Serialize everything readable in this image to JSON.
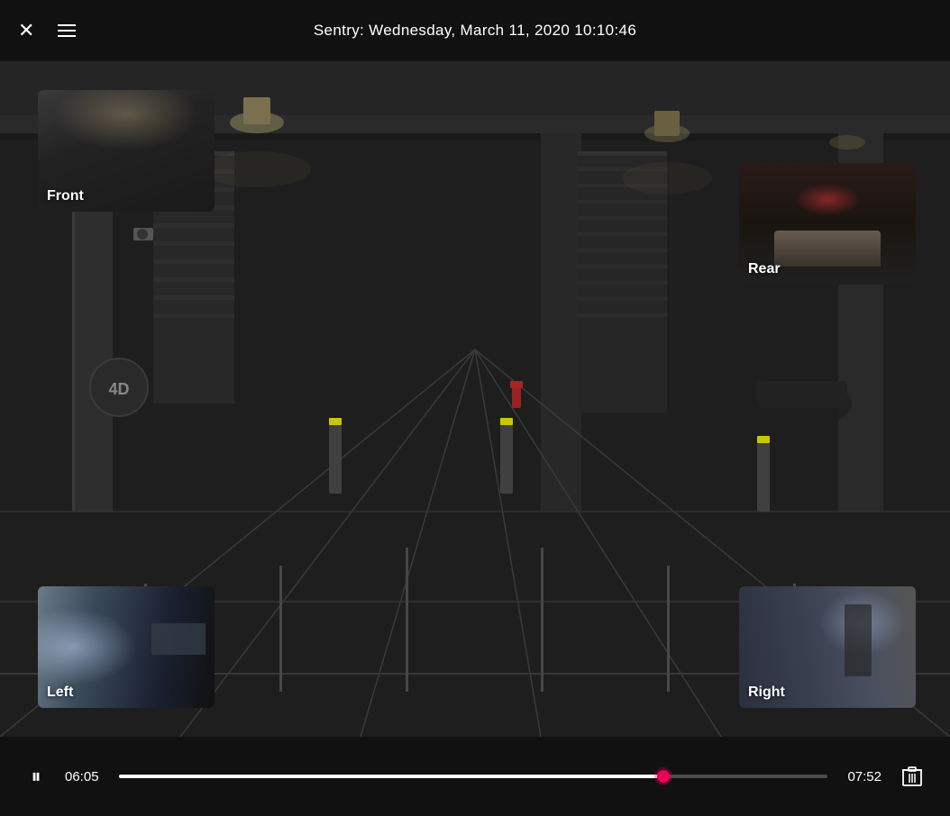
{
  "topbar": {
    "title": "Sentry: Wednesday, March 11, 2020 10:10:46",
    "close_label": "✕"
  },
  "thumbnails": {
    "front": {
      "label": "Front"
    },
    "rear": {
      "label": "Rear"
    },
    "left": {
      "label": "Left"
    },
    "right": {
      "label": "Right"
    }
  },
  "controls": {
    "time_current": "06:05",
    "time_total": "07:52",
    "progress_percent": 77
  }
}
